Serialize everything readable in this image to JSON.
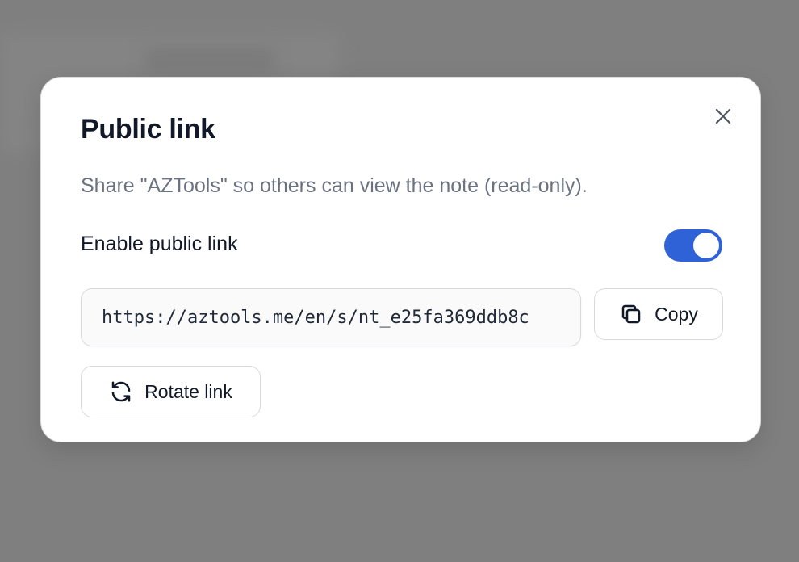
{
  "dialog": {
    "title": "Public link",
    "description": "Share \"AZTools\" so others can view the note (read-only).",
    "close_icon": "close-icon",
    "toggle": {
      "label": "Enable public link",
      "enabled": true,
      "accent_color": "#2f62d6"
    },
    "link": {
      "value": "https://aztools.me/en/s/nt_e25fa369ddb8c"
    },
    "copy_button": {
      "label": "Copy",
      "icon": "copy-icon"
    },
    "rotate_button": {
      "label": "Rotate link",
      "icon": "refresh-icon"
    }
  }
}
